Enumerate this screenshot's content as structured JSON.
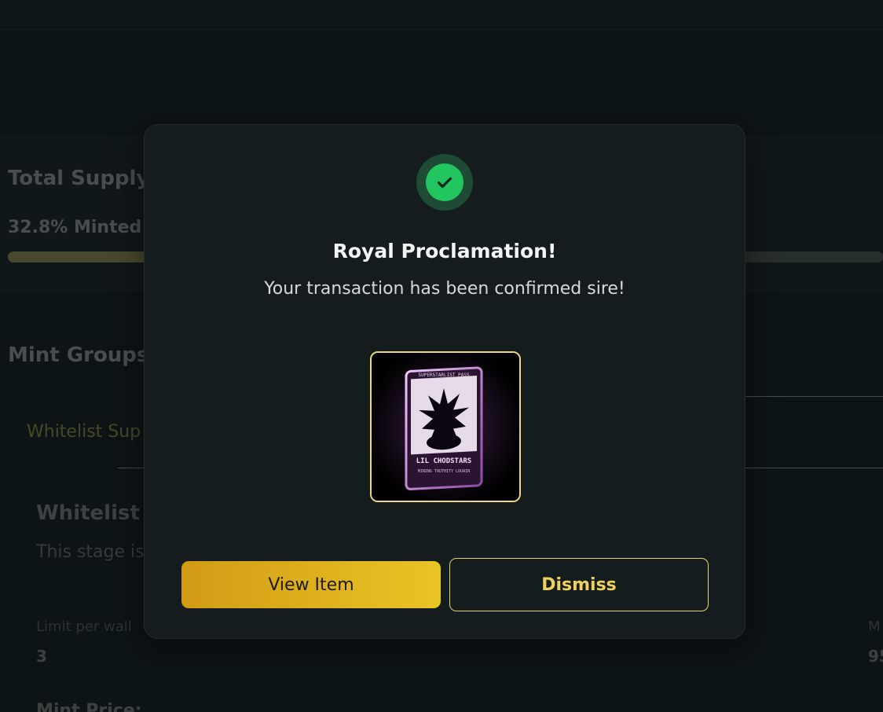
{
  "background": {
    "total_supply_label": "Total Supply",
    "minted_label": "32.8% Minted",
    "minted_fraction": 0.328,
    "mint_groups_label": "Mint Groups",
    "whitelist_tab_label": "Whitelist Sup",
    "stage_title": "Whitelist S",
    "stage_description": "This stage is",
    "limit_label": "Limit per wall",
    "limit_value": "3",
    "right_label": "M",
    "right_value": "95",
    "mint_price_label": "Mint Price:"
  },
  "modal": {
    "icon": "check-circle-icon",
    "title": "Royal Proclamation!",
    "message": "Your transaction has been confirmed sire!",
    "nft": {
      "header_text": "SUPERSTARLIST PASS",
      "name_text": "LIL CHODSTARS",
      "footer_text": "MINING TAUTHITY LOUAIN"
    },
    "buttons": {
      "view_label": "View Item",
      "dismiss_label": "Dismiss"
    }
  },
  "colors": {
    "success": "#22c55e",
    "accent_gold": "#e9c524",
    "card_glow": "#c58bd6"
  }
}
